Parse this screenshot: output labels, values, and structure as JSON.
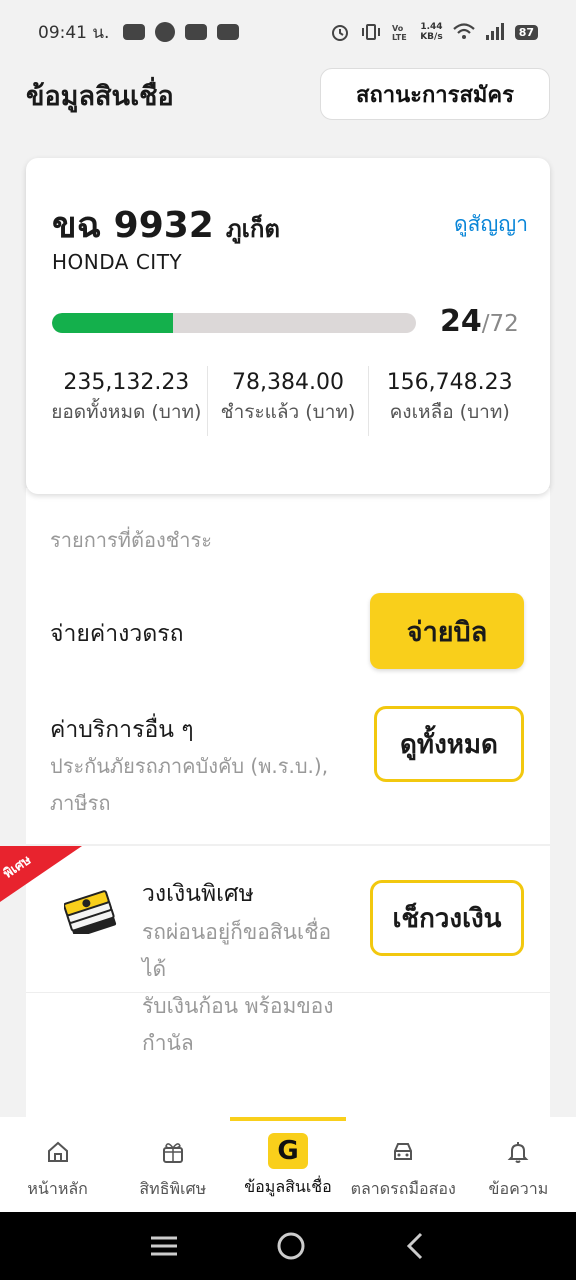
{
  "status_bar": {
    "time": "09:41 น.",
    "netspeed_value": "1.44",
    "netspeed_unit": "KB/s",
    "battery": "87"
  },
  "header": {
    "title": "ข้อมูลสินเชื่อ",
    "status_button": "สถานะการสมัคร"
  },
  "loan": {
    "plate_number": "ขฉ 9932",
    "province": "ภูเก็ต",
    "contract_link": "ดูสัญญา",
    "car_model": "HONDA CITY",
    "installments_paid": "24",
    "installments_total": "/72",
    "progress_fraction": 0.333,
    "summary": [
      {
        "value": "235,132.23",
        "label": "ยอดทั้งหมด (บาท)"
      },
      {
        "value": "78,384.00",
        "label": "ชำระแล้ว (บาท)"
      },
      {
        "value": "156,748.23",
        "label": "คงเหลือ (บาท)"
      }
    ]
  },
  "payments": {
    "section_title": "รายการที่ต้องชำระ",
    "car_installment": "จ่ายค่างวดรถ",
    "pay_button": "จ่ายบิล",
    "other_title": "ค่าบริการอื่น ๆ",
    "other_desc": "ประกันภัยรถภาคบังคับ (พ.ร.บ.), ภาษีรถ",
    "view_all_button": "ดูทั้งหมด",
    "special_ribbon": "พิเศษ",
    "special_title": "วงเงินพิเศษ",
    "special_desc": "รถผ่อนอยู่ก็ขอสินเชื่อได้",
    "special_desc2": "รับเงินก้อน พร้อมของกำนัล",
    "check_button": "เช็กวงเงิน"
  },
  "bottom_nav": [
    {
      "label": "หน้าหลัก",
      "icon": "home-icon"
    },
    {
      "label": "สิทธิพิเศษ",
      "icon": "gift-icon"
    },
    {
      "label": "ข้อมูลสินเชื่อ",
      "icon": "g-logo-icon",
      "active": true
    },
    {
      "label": "ตลาดรถมือสอง",
      "icon": "car-icon"
    },
    {
      "label": "ข้อความ",
      "icon": "bell-icon"
    }
  ],
  "nav_active_glyph": "G",
  "colors": {
    "accent_yellow": "#f9cf1b",
    "progress_green": "#14b04c",
    "link_blue": "#0a86d8",
    "ribbon_red": "#e8232e"
  }
}
